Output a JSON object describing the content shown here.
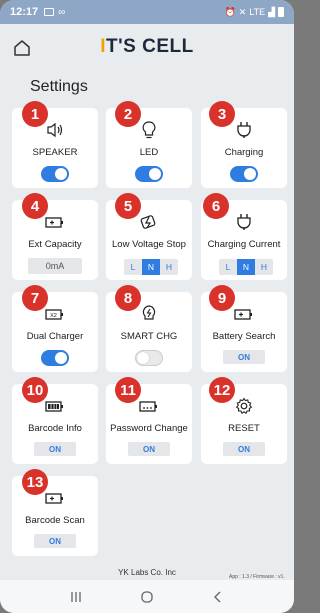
{
  "status": {
    "time": "12:17",
    "network": "LTE"
  },
  "app": {
    "brand_i": "I",
    "brand_rest": "T'S CELL"
  },
  "page": {
    "title": "Settings"
  },
  "cards": [
    {
      "num": "1",
      "label": "SPEAKER",
      "icon": "speaker-icon",
      "control": "toggle",
      "state": "on"
    },
    {
      "num": "2",
      "label": "LED",
      "icon": "bulb-icon",
      "control": "toggle",
      "state": "on"
    },
    {
      "num": "3",
      "label": "Charging",
      "icon": "plug-icon",
      "control": "toggle",
      "state": "on"
    },
    {
      "num": "4",
      "label": "Ext Capacity",
      "icon": "battery-plus-icon",
      "control": "value",
      "value": "0mA"
    },
    {
      "num": "5",
      "label": "Low Voltage Stop",
      "icon": "low-voltage-icon",
      "control": "segment",
      "options": [
        "L",
        "N",
        "H"
      ],
      "selected": "N"
    },
    {
      "num": "6",
      "label": "Charging Current",
      "icon": "plug-icon",
      "control": "segment",
      "options": [
        "L",
        "N",
        "H"
      ],
      "selected": "N"
    },
    {
      "num": "7",
      "label": "Dual Charger",
      "icon": "battery-x2-icon",
      "control": "toggle",
      "state": "on"
    },
    {
      "num": "8",
      "label": "SMART CHG",
      "icon": "smart-bulb-icon",
      "control": "toggle",
      "state": "off"
    },
    {
      "num": "9",
      "label": "Battery Search",
      "icon": "battery-search-icon",
      "control": "button",
      "value": "ON"
    },
    {
      "num": "10",
      "label": "Barcode Info",
      "icon": "barcode-icon",
      "control": "button",
      "value": "ON"
    },
    {
      "num": "11",
      "label": "Password Change",
      "icon": "battery-dots-icon",
      "control": "button",
      "value": "ON"
    },
    {
      "num": "12",
      "label": "RESET",
      "icon": "gear-icon",
      "control": "button",
      "value": "ON"
    },
    {
      "num": "13",
      "label": "Barcode Scan",
      "icon": "battery-scan-icon",
      "control": "button",
      "value": "ON"
    }
  ],
  "footer": {
    "company": "YK Labs Co. Inc",
    "version": "App : 1.3 / Firmware : v1."
  },
  "colors": {
    "accent": "#2f7de1",
    "badge": "#d8322a",
    "brand_accent": "#f2a000"
  }
}
